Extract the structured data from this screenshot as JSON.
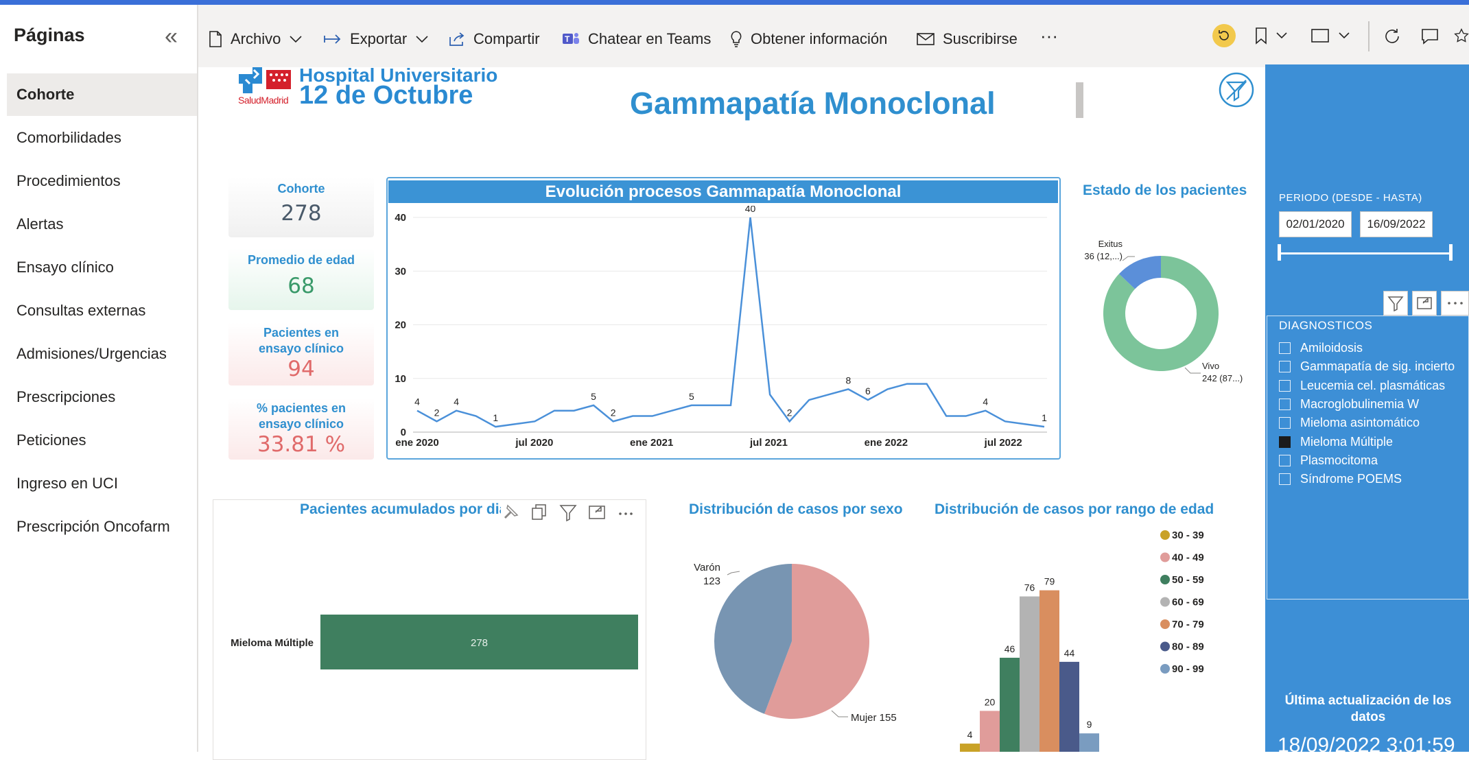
{
  "sidebar": {
    "title": "Páginas",
    "items": [
      {
        "label": "Cohorte",
        "active": true
      },
      {
        "label": "Comorbilidades"
      },
      {
        "label": "Procedimientos"
      },
      {
        "label": "Alertas"
      },
      {
        "label": "Ensayo clínico"
      },
      {
        "label": "Consultas externas"
      },
      {
        "label": "Admisiones/Urgencias"
      },
      {
        "label": "Prescripciones"
      },
      {
        "label": "Peticiones"
      },
      {
        "label": "Ingreso en UCI"
      },
      {
        "label": "Prescripción Oncofarm"
      }
    ]
  },
  "toolbar": {
    "archivo": "Archivo",
    "exportar": "Exportar",
    "compartir": "Compartir",
    "teams": "Chatear en Teams",
    "info": "Obtener información",
    "suscribirse": "Suscribirse",
    "more": "···"
  },
  "logo": {
    "line1": "Hospital Universitario",
    "line2": "12 de Octubre",
    "salud": "SaludMadrid"
  },
  "report": {
    "title": "Gammapatía Monoclonal"
  },
  "kpis": [
    {
      "label": "Cohorte",
      "value": "278",
      "color": "#4a5a6a"
    },
    {
      "label": "Promedio de edad",
      "value": "68",
      "color": "#3a9a6a"
    },
    {
      "label": "Pacientes en ensayo clínico",
      "value": "94",
      "color": "#e06a6a"
    },
    {
      "label": "% pacientes en ensayo clínico",
      "value": "33.81 %",
      "color": "#e06a6a"
    }
  ],
  "titles": {
    "estado": "Estado de los pacientes",
    "acumulados": "Pacientes acumulados por dia",
    "sexo": "Distribución de casos por sexo",
    "edad": "Distribución de casos por rango de edad"
  },
  "right_pane": {
    "periodo_label": "PERIODO (DESDE - HASTA)",
    "date_from": "02/01/2020",
    "date_to": "16/09/2022",
    "diag_title": "DIAGNOSTICOS",
    "diagnosticos": [
      {
        "label": "Amiloidosis",
        "checked": false
      },
      {
        "label": "Gammapatía de sig. incierto",
        "checked": false
      },
      {
        "label": "Leucemia cel. plasmáticas",
        "checked": false
      },
      {
        "label": "Macroglobulinemia W",
        "checked": false
      },
      {
        "label": "Mieloma asintomático",
        "checked": false
      },
      {
        "label": "Mieloma Múltiple",
        "checked": true
      },
      {
        "label": "Plasmocitoma",
        "checked": false
      },
      {
        "label": "Síndrome POEMS",
        "checked": false
      }
    ],
    "ultima_label": "Última actualización de los datos",
    "ultima_value": "18/09/2022 3:01:59"
  },
  "colors": {
    "accent": "#2f8fcf",
    "pane": "#3d8fd6",
    "line": "#4a90d9"
  },
  "chart_data": [
    {
      "type": "line",
      "title": "Evolución procesos Gammapatía Monoclonal",
      "x_ticks": [
        "ene 2020",
        "jul 2020",
        "ene 2021",
        "jul 2021",
        "ene 2022",
        "jul 2022"
      ],
      "y_ticks": [
        "0",
        "10",
        "20",
        "30",
        "40"
      ],
      "ylim": [
        0,
        40
      ],
      "grid": true,
      "x_months": [
        0,
        1,
        2,
        3,
        4,
        5,
        6,
        7,
        8,
        9,
        10,
        11,
        12,
        13,
        14,
        15,
        16,
        17,
        18,
        19,
        20,
        21,
        22,
        23,
        24,
        25,
        26,
        27,
        28,
        29,
        30,
        31,
        32,
        33,
        34
      ],
      "values": [
        4,
        2,
        4,
        3,
        1,
        1.5,
        2,
        4,
        4,
        5,
        2,
        3,
        3,
        4,
        5,
        5,
        5,
        40,
        7,
        2,
        6,
        7,
        8,
        6,
        8,
        9,
        9,
        3,
        3,
        4,
        2,
        1.5,
        1
      ],
      "labels": [
        {
          "i": 0,
          "text": "4"
        },
        {
          "i": 1,
          "text": "2"
        },
        {
          "i": 2,
          "text": "4"
        },
        {
          "i": 4,
          "text": "1"
        },
        {
          "i": 9,
          "text": "5"
        },
        {
          "i": 10,
          "text": "2"
        },
        {
          "i": 14,
          "text": "5"
        },
        {
          "i": 17,
          "text": "40"
        },
        {
          "i": 19,
          "text": "2"
        },
        {
          "i": 22,
          "text": "8"
        },
        {
          "i": 23,
          "text": "6"
        },
        {
          "i": 29,
          "text": "4"
        },
        {
          "i": 32,
          "text": "1"
        }
      ]
    },
    {
      "type": "pie",
      "title": "Estado de los pacientes",
      "donut": true,
      "slices": [
        {
          "name": "Vivo",
          "value": 242,
          "label": "Vivo",
          "label2": "242 (87...)",
          "color": "#7cc49a"
        },
        {
          "name": "Exitus",
          "value": 36,
          "label": "Exitus",
          "label2": "36 (12,...)",
          "color": "#5b8fd9"
        }
      ]
    },
    {
      "type": "bar",
      "title": "Pacientes acumulados por dia",
      "categories": [
        "Mieloma Múltiple"
      ],
      "values": [
        278
      ],
      "value_labels": [
        "278"
      ],
      "color": "#3f7f5f"
    },
    {
      "type": "pie",
      "title": "Distribución de casos por sexo",
      "slices": [
        {
          "name": "Mujer",
          "value": 155,
          "label": "Mujer 155",
          "color": "#e09c9a"
        },
        {
          "name": "Varón",
          "value": 123,
          "label": "Varón\n123",
          "color": "#7895b2"
        }
      ]
    },
    {
      "type": "bar",
      "title": "Distribución de casos por rango de edad",
      "categories": [
        "30 - 39",
        "40 - 49",
        "50 - 59",
        "60 - 69",
        "70 - 79",
        "80 - 89",
        "90 - 99"
      ],
      "values": [
        4,
        20,
        46,
        76,
        79,
        44,
        9
      ],
      "colors": [
        "#c9a227",
        "#e09c9a",
        "#3f7f5f",
        "#b3b3b3",
        "#d98e5f",
        "#4a5a8a",
        "#7a9cc0"
      ],
      "legend": "right"
    }
  ]
}
